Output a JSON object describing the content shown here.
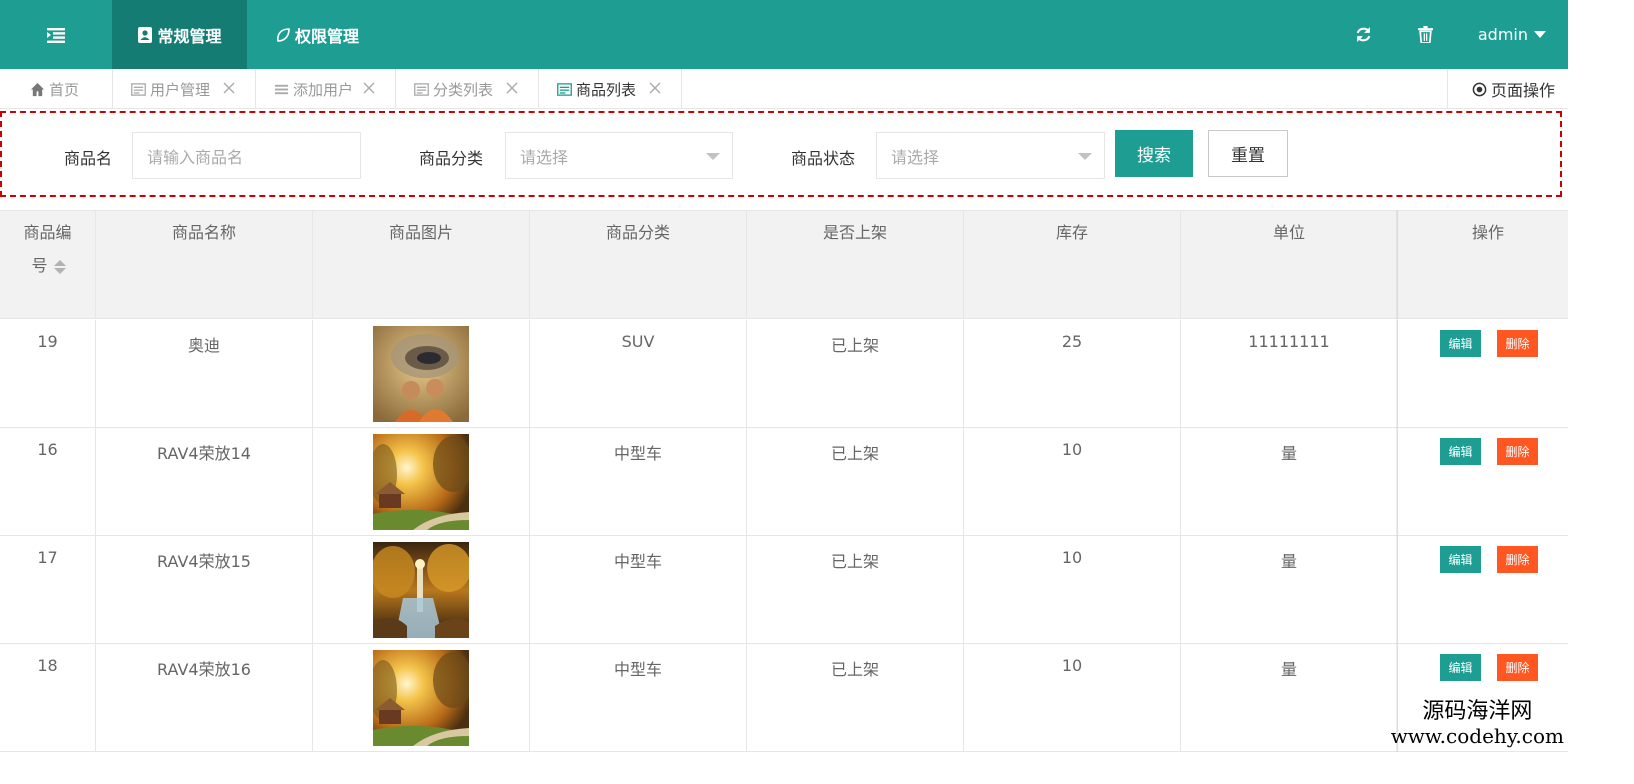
{
  "header": {
    "tabs": [
      {
        "label": "常规管理",
        "icon": "address-card-icon"
      },
      {
        "label": "权限管理",
        "icon": "leaf-icon"
      }
    ],
    "user": "admin",
    "colors": {
      "primary": "#1e9e93",
      "primary_dark": "#157c73"
    }
  },
  "tabs_bar": {
    "tabs": [
      {
        "label": "首页",
        "icon": "home-icon"
      },
      {
        "label": "用户管理",
        "icon": "list-card-icon"
      },
      {
        "label": "添加用户",
        "icon": "bars-icon"
      },
      {
        "label": "分类列表",
        "icon": "list-card-icon"
      },
      {
        "label": "商品列表",
        "icon": "list-card-icon"
      }
    ],
    "page_op": "页面操作"
  },
  "search": {
    "name_label": "商品名",
    "name_placeholder": "请输入商品名",
    "category_label": "商品分类",
    "category_value": "请选择",
    "status_label": "商品状态",
    "status_value": "请选择",
    "search_btn": "搜索",
    "reset_btn": "重置"
  },
  "table": {
    "columns": [
      "商品编号",
      "商品名称",
      "商品图片",
      "商品分类",
      "是否上架",
      "库存",
      "单位",
      "操作"
    ],
    "col_id_line1": "商品编",
    "col_id_line2": "号",
    "rows": [
      {
        "id": "19",
        "name": "奥迪",
        "image": "monks-painting",
        "category": "SUV",
        "status": "已上架",
        "stock": "25",
        "unit": "11111111"
      },
      {
        "id": "16",
        "name": "RAV4荣放14",
        "image": "autumn-sunset-cottage",
        "category": "中型车",
        "status": "已上架",
        "stock": "10",
        "unit": "量"
      },
      {
        "id": "17",
        "name": "RAV4荣放15",
        "image": "forest-waterfall",
        "category": "中型车",
        "status": "已上架",
        "stock": "10",
        "unit": "量"
      },
      {
        "id": "18",
        "name": "RAV4荣放16",
        "image": "autumn-sunset-cottage",
        "category": "中型车",
        "status": "已上架",
        "stock": "10",
        "unit": "量"
      }
    ],
    "edit_label": "编辑",
    "delete_label": "删除"
  },
  "watermark": {
    "line1": "源码海洋网",
    "line2": "www.codehy.com"
  }
}
